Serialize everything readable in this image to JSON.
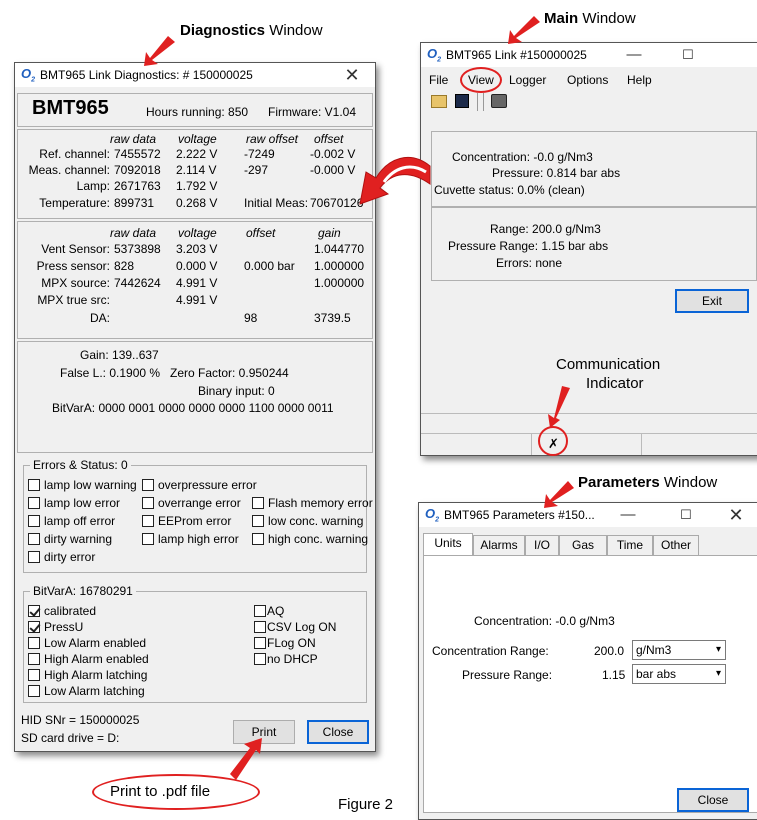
{
  "annotations": {
    "diag_bold": "Diagnostics",
    "diag_rest": " Window",
    "main_bold": "Main",
    "main_rest": " Window",
    "comm_line1": "Communication",
    "comm_line2": "Indicator",
    "param_bold": "Parameters",
    "param_rest": " Window",
    "print_pdf": "Print to .pdf file",
    "figure": "Figure 2"
  },
  "colors": {
    "accent": "#0a64d6",
    "annotation_red": "#e02020",
    "app_icon": "#1f5fbf"
  },
  "diag": {
    "title": "BMT965 Link Diagnostics: # 150000025",
    "close_glyph": "✕",
    "device": "BMT965",
    "hours": "Hours running: 850",
    "firmware": "Firmware: V1.04",
    "hdr1": [
      "raw data",
      "voltage",
      "raw offset",
      "offset"
    ],
    "rows1": [
      {
        "label": "Ref. channel:",
        "raw": "7455572",
        "volt": "2.222 V",
        "roff": "-7249",
        "off": "-0.002 V"
      },
      {
        "label": "Meas. channel:",
        "raw": "7092018",
        "volt": "2.114 V",
        "roff": "-297",
        "off": "-0.000 V"
      },
      {
        "label": "Lamp:",
        "raw": "2671763",
        "volt": "1.792 V",
        "roff": "",
        "off": ""
      },
      {
        "label": "Temperature:",
        "raw": "899731",
        "volt": "0.268 V",
        "roff": "Initial Meas:",
        "off": "70670126"
      }
    ],
    "hdr2": [
      "raw data",
      "voltage",
      "offset",
      "gain"
    ],
    "rows2": [
      {
        "label": "Vent Sensor:",
        "raw": "5373898",
        "volt": "3.203 V",
        "off": "",
        "gain": "1.044770"
      },
      {
        "label": "Press sensor:",
        "raw": "828",
        "volt": "0.000 V",
        "off": "0.000 bar",
        "gain": "1.000000"
      },
      {
        "label": "MPX source:",
        "raw": "7442624",
        "volt": "4.991 V",
        "off": "",
        "gain": "1.000000"
      },
      {
        "label": "MPX true src:",
        "raw": "",
        "volt": "4.991 V",
        "off": "",
        "gain": ""
      },
      {
        "label": "DA:",
        "raw": "",
        "volt": "",
        "off": "98",
        "gain": "3739.5"
      }
    ],
    "gain": "Gain: 139..637",
    "false_l": "False L.: 0.1900 %",
    "zero_factor": "Zero Factor: 0.950244",
    "binary_input": "Binary input: 0",
    "bitvar_line": "BitVarA: 0000 0001  0000 0000  0000 1100  0000 0011",
    "errors_title": "Errors & Status: 0",
    "errors": [
      {
        "label": "lamp low warning",
        "checked": false
      },
      {
        "label": "overpressure error",
        "checked": false
      },
      {
        "label": "lamp low error",
        "checked": false
      },
      {
        "label": "overrange error",
        "checked": false
      },
      {
        "label": "Flash memory error",
        "checked": false
      },
      {
        "label": "lamp off error",
        "checked": false
      },
      {
        "label": "EEProm error",
        "checked": false
      },
      {
        "label": "low conc. warning",
        "checked": false
      },
      {
        "label": "dirty warning",
        "checked": false
      },
      {
        "label": "lamp high error",
        "checked": false
      },
      {
        "label": "high conc. warning",
        "checked": false
      },
      {
        "label": "dirty error",
        "checked": false
      }
    ],
    "bitvar_title": "BitVarA:  16780291",
    "bits": [
      {
        "label": "calibrated",
        "checked": true
      },
      {
        "label": "PressU",
        "checked": true
      },
      {
        "label": "Low Alarm enabled",
        "checked": false
      },
      {
        "label": "High Alarm enabled",
        "checked": false
      },
      {
        "label": "High Alarm latching",
        "checked": false
      },
      {
        "label": "Low Alarm latching",
        "checked": false
      },
      {
        "label": "AQ",
        "checked": false
      },
      {
        "label": "CSV Log ON",
        "checked": false
      },
      {
        "label": "FLog ON",
        "checked": false
      },
      {
        "label": "no DHCP",
        "checked": false
      }
    ],
    "hid": "HID SNr = 150000025",
    "sd": "SD card drive = D:",
    "print_label": "Print",
    "close_label": "Close"
  },
  "main": {
    "title": "BMT965 Link #150000025",
    "menu": [
      "File",
      "View",
      "Logger",
      "Options",
      "Help"
    ],
    "concentration": "Concentration: -0.0 g/Nm3",
    "pressure": "Pressure: 0.814 bar abs",
    "cuvette": "Cuvette status: 0.0% (clean)",
    "range": "Range: 200.0 g/Nm3",
    "pressure_range": "Pressure Range: 1.15 bar abs",
    "errors": "Errors: none",
    "exit_label": "Exit",
    "comm_glyph": "✗"
  },
  "params": {
    "title": "BMT965 Parameters #150...",
    "tabs": [
      "Units",
      "Alarms",
      "I/O",
      "Gas",
      "Time",
      "Other"
    ],
    "concentration": "Concentration:  -0.0 g/Nm3",
    "conc_range_label": "Concentration Range:",
    "conc_range_value": "200.0",
    "conc_range_unit": "g/Nm3",
    "pressure_range_label": "Pressure Range:",
    "pressure_range_value": "1.15",
    "pressure_range_unit": "bar abs",
    "close_label": "Close"
  }
}
